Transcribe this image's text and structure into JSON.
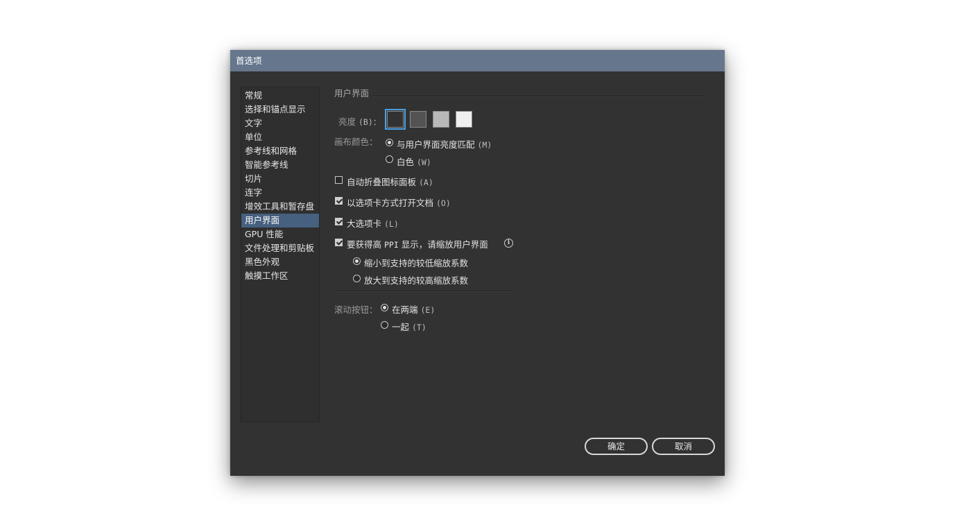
{
  "window": {
    "title": "首选项"
  },
  "sidebar": {
    "items": [
      {
        "label": "常规"
      },
      {
        "label": "选择和锚点显示"
      },
      {
        "label": "文字"
      },
      {
        "label": "单位"
      },
      {
        "label": "参考线和网格"
      },
      {
        "label": "智能参考线"
      },
      {
        "label": "切片"
      },
      {
        "label": "连字"
      },
      {
        "label": "增效工具和暂存盘"
      },
      {
        "label": "用户界面",
        "selected": true
      },
      {
        "label": "GPU 性能"
      },
      {
        "label": "文件处理和剪贴板"
      },
      {
        "label": "黑色外观"
      },
      {
        "label": "触摸工作区"
      }
    ]
  },
  "main": {
    "section_title": "用户界面",
    "brightness": {
      "label": "亮度",
      "shortcut": "(B)：",
      "swatches": [
        {
          "color": "#323232",
          "selected": true
        },
        {
          "color": "#535353",
          "selected": false
        },
        {
          "color": "#b8b8b8",
          "selected": false
        },
        {
          "color": "#f0f0f0",
          "selected": false
        }
      ]
    },
    "canvas_color": {
      "label": "画布颜色：",
      "options": [
        {
          "label": "与用户界面亮度匹配",
          "shortcut": "(M)",
          "checked": true
        },
        {
          "label": "白色",
          "shortcut": "(W)",
          "checked": false
        }
      ]
    },
    "checkboxes": {
      "auto_collapse": {
        "label": "自动折叠图标面板",
        "shortcut": "(A)",
        "checked": false
      },
      "open_as_tabs": {
        "label": "以选项卡方式打开文档",
        "shortcut": "(O)",
        "checked": true
      },
      "large_tabs": {
        "label": "大选项卡",
        "shortcut": "(L)",
        "checked": true
      },
      "high_ppi": {
        "label_prefix": "要获得高",
        "label_ppi": "PPI",
        "label_suffix": "显示，请缩放用户界面",
        "checked": true
      }
    },
    "scale_options": [
      {
        "label": "缩小到支持的较低缩放系数",
        "checked": true
      },
      {
        "label": "放大到支持的较高缩放系数",
        "checked": false
      }
    ],
    "scroll_buttons": {
      "label": "滚动按钮：",
      "options": [
        {
          "label": "在两端",
          "shortcut": "(E)",
          "checked": true
        },
        {
          "label": "一起",
          "shortcut": "(T)",
          "checked": false
        }
      ]
    }
  },
  "buttons": {
    "ok": "确定",
    "cancel": "取消"
  },
  "colors": {
    "titlebar": "#66768c",
    "background": "#323232",
    "selection": "#46607f",
    "focus": "#4aa0e6"
  }
}
